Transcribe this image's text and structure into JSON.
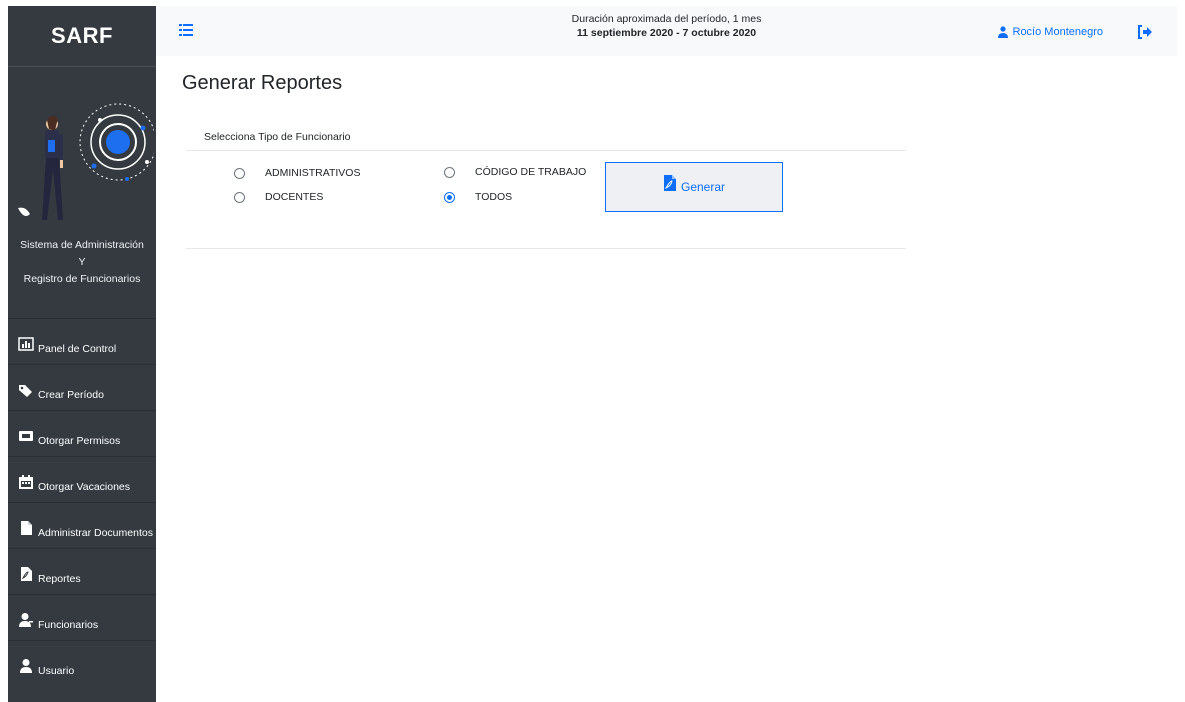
{
  "sidebar": {
    "brand": "SARF",
    "subtitle_line1": "Sistema de Administración",
    "subtitle_line2": "Y",
    "subtitle_line3": "Registro de Funcionarios",
    "items": [
      {
        "label": "Panel de Control",
        "icon": "chart-icon"
      },
      {
        "label": "Crear Período",
        "icon": "tags-icon"
      },
      {
        "label": "Otorgar Permisos",
        "icon": "ticket-icon"
      },
      {
        "label": "Otorgar Vacaciones",
        "icon": "calendar-icon"
      },
      {
        "label": "Administrar Documentos",
        "icon": "file-icon"
      },
      {
        "label": "Reportes",
        "icon": "pdf-icon"
      },
      {
        "label": "Funcionarios",
        "icon": "user-tie-icon"
      },
      {
        "label": "Usuario",
        "icon": "user-icon"
      }
    ]
  },
  "topbar": {
    "period_line1": "Duración aproximada del período, 1 mes",
    "period_line2": "11 septiembre 2020 - 7 octubre 2020",
    "user_name": "Rocío Montenegro"
  },
  "main": {
    "title": "Generar Reportes",
    "section_label": "Selecciona Tipo de Funcionario",
    "options": [
      {
        "label": "ADMINISTRATIVOS",
        "checked": false
      },
      {
        "label": "DOCENTES",
        "checked": false
      },
      {
        "label": "CÓDIGO DE TRABAJO",
        "checked": false
      },
      {
        "label": "TODOS",
        "checked": true
      }
    ],
    "generate_label": "Generar"
  },
  "colors": {
    "sidebar_bg": "#343a40",
    "accent": "#0d6efd",
    "topbar_bg": "#f8f9fa"
  }
}
